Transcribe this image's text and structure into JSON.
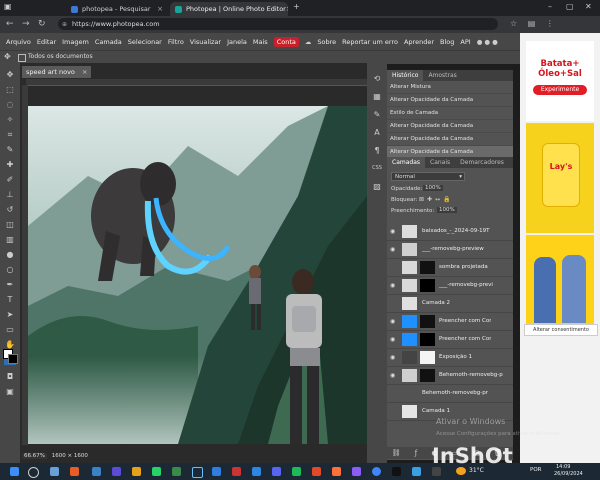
{
  "browser": {
    "tabs": [
      {
        "label": "photopea - Pesquisar",
        "active": false
      },
      {
        "label": "Photopea | Online Photo Editor",
        "active": true
      }
    ],
    "new_tab": "+",
    "url": "https://www.photopea.com"
  },
  "menu": {
    "items": [
      "Arquivo",
      "Editar",
      "Imagem",
      "Camada",
      "Selecionar",
      "Filtro",
      "Visualizar",
      "Janela",
      "Mais"
    ],
    "account": "Conta",
    "right_items": [
      "Sobre",
      "Reportar um erro",
      "Aprender",
      "Blog",
      "API"
    ]
  },
  "options": {
    "all_docs": "Todos os documentos"
  },
  "document": {
    "tab": "speed art novo",
    "zoom_readout": "66.67%",
    "size_readout": "1600 × 1600"
  },
  "history": {
    "tabs": [
      "Histórico",
      "Amostras"
    ],
    "items": [
      "Alterar Mistura",
      "Alterar Opacidade da Camada",
      "Estilo de Camada",
      "Alterar Opacidade da Camada",
      "Alterar Opacidade da Camada",
      "Alterar Opacidade da Camada"
    ]
  },
  "layers_panel": {
    "tabs": [
      "Camadas",
      "Canais",
      "Demarcadores"
    ],
    "blend_mode": "Normal",
    "opacity_label": "Opacidade:",
    "opacity_value": "100%",
    "lock_label": "Bloquear:",
    "fill_label": "Preenchimento:",
    "fill_value": "100%",
    "layers": [
      {
        "name": "baixados_-_2024-09-19T"
      },
      {
        "name": "___-removebg-preview"
      },
      {
        "name": "sombra projetada"
      },
      {
        "name": "___-removebg-previ"
      },
      {
        "name": "Camada 2"
      },
      {
        "name": "Preencher com Cor"
      },
      {
        "name": "Preencher com Cor"
      },
      {
        "name": "Exposição 1"
      },
      {
        "name": "Behemoth-removebg-p"
      },
      {
        "name": "Behemoth-removebg-pr"
      },
      {
        "name": "Camada 1"
      }
    ]
  },
  "ad": {
    "brand": "Batata+",
    "tagline": "Óleo+Sal",
    "cta": "Experimente",
    "product": "Lay's",
    "consent": "Alterar consentimento"
  },
  "windows": {
    "activate_title": "Ativar o Windows",
    "activate_sub": "Acesse Configurações para ativar o Windows.",
    "weather": "31°C",
    "lang": "POR",
    "time": "14:09",
    "date": "26/09/2024"
  },
  "watermark": "InShOt",
  "colors": {
    "accent_red": "#c7212b",
    "panel_bg": "#535353",
    "chrome_bg": "#202124",
    "selection_blue": "#1e90ff"
  }
}
